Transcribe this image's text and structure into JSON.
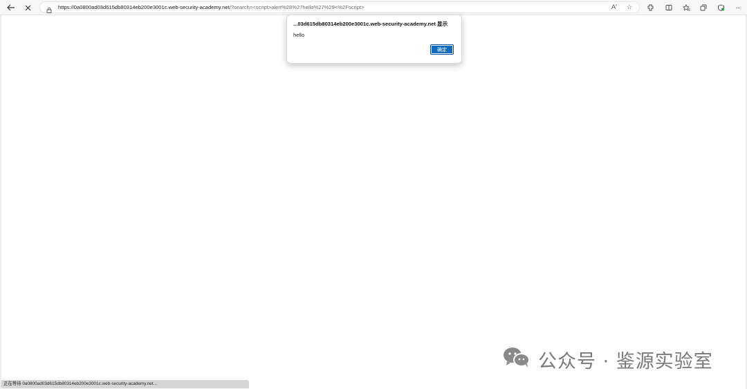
{
  "browser": {
    "url_host": "https://0a0800ad03d615db80314eb200e3001c.web-security-academy.net",
    "url_rest": "/?search=<script>alert%28%27hello%27%29<%2Fscript>",
    "icons": [
      "back-arrow-icon",
      "stop-icon",
      "lock-icon",
      "read-aloud-icon",
      "favorite-star-icon",
      "extensions-icon",
      "split-screen-icon",
      "favorites-icon",
      "collections-icon",
      "browser-essentials-icon",
      "more-icon"
    ]
  },
  "dialog": {
    "title": "...03d615db80314eb200e3001c.web-security-academy.net 显示",
    "message": "hello",
    "ok_label": "确定"
  },
  "status_bar": {
    "text": "正在等待 0a0800ad03d615db80314eb200e3001c.web-security-academy.net..."
  },
  "watermark": {
    "text": "公众号 · 鉴源实验室"
  }
}
